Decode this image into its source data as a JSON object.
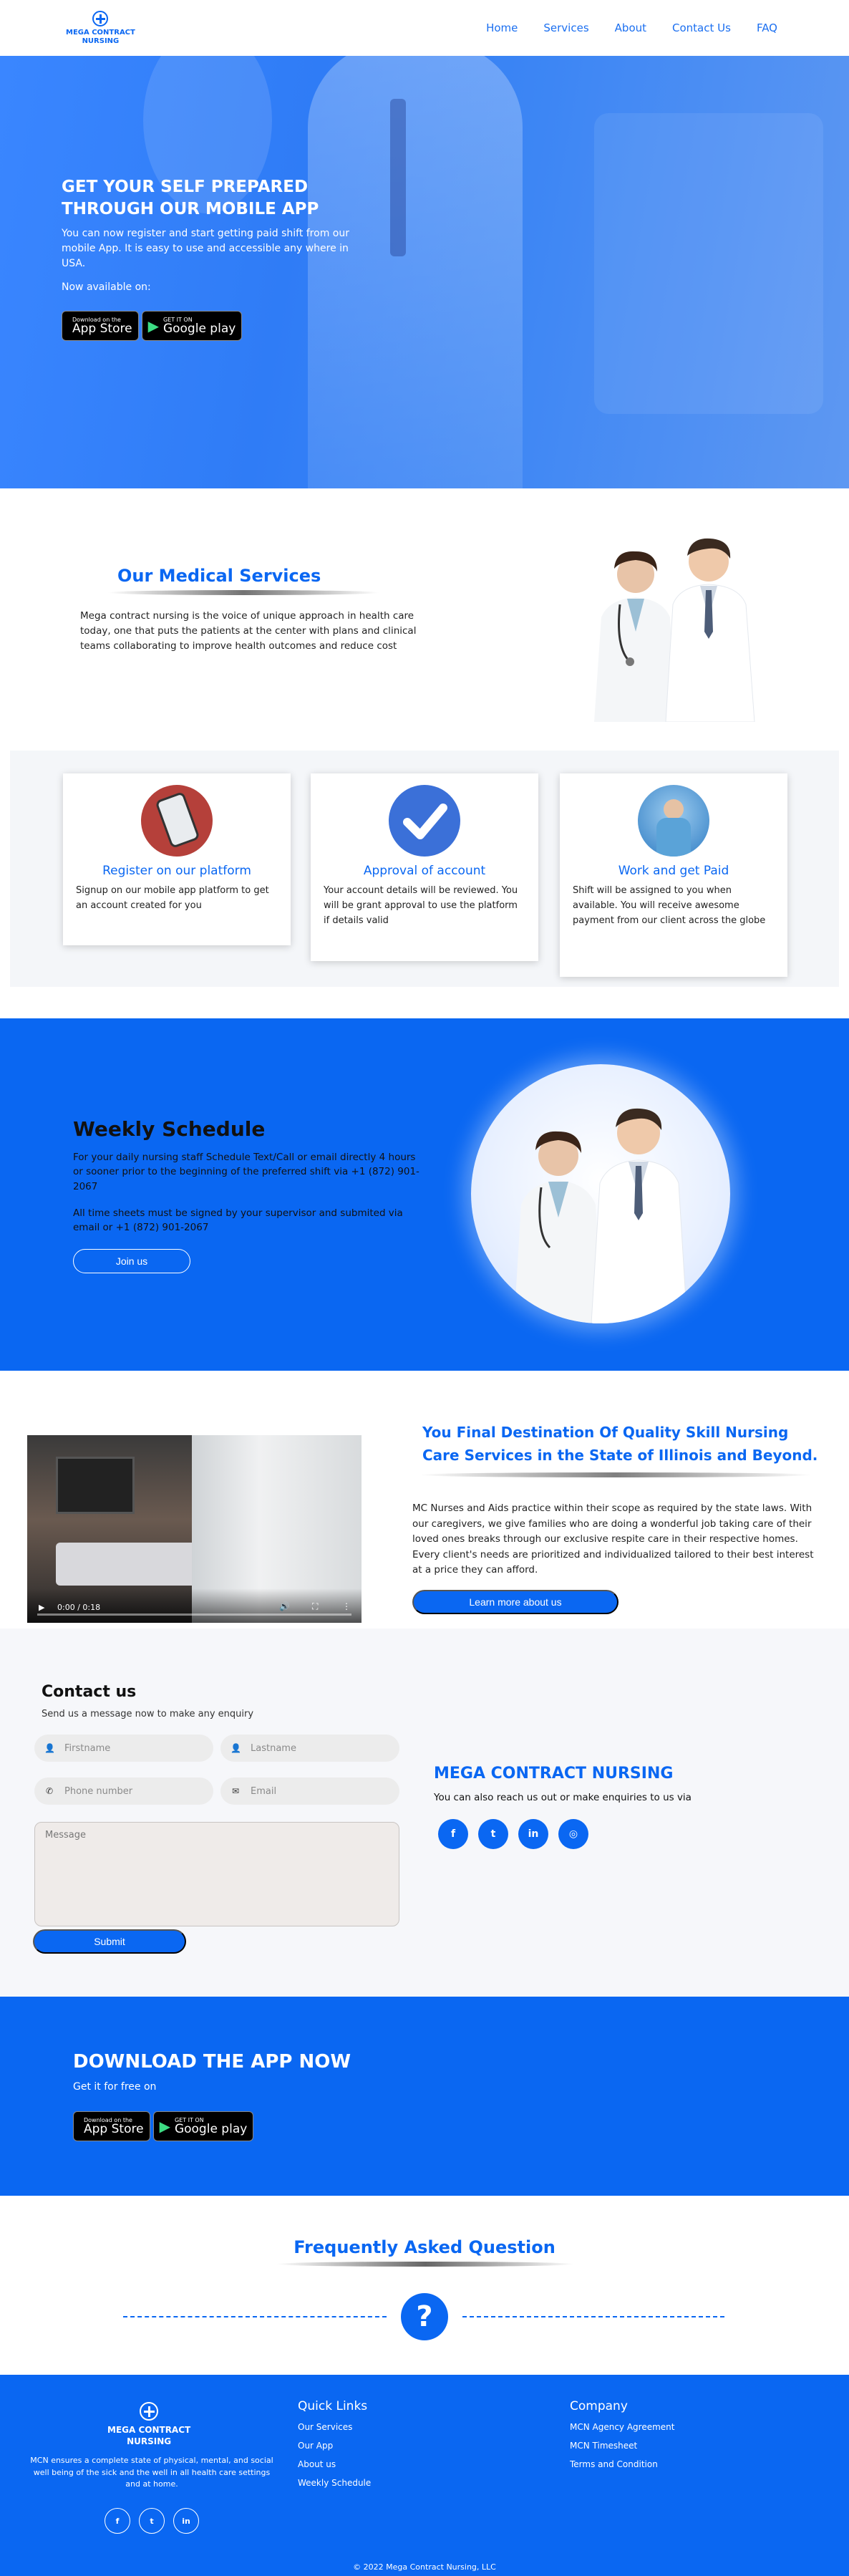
{
  "brand": {
    "line1": "MEGA CONTRACT",
    "line2": "NURSING"
  },
  "nav": {
    "items": [
      "Home",
      "Services",
      "About",
      "Contact Us",
      "FAQ"
    ]
  },
  "hero": {
    "title_line1": "GET YOUR SELF PREPARED",
    "title_line2": "THROUGH OUR MOBILE APP",
    "text": "You can now register and start getting paid shift from our mobile App. It is easy to use and accessible any where in USA.",
    "available": "Now available on:"
  },
  "badges": {
    "appstore_small": "Download on the",
    "appstore_big": "App Store",
    "play_small": "GET IT ON",
    "play_big": "Google play"
  },
  "medical": {
    "title": "Our Medical Services",
    "text": "Mega contract nursing is the voice of unique approach in health care today, one that puts the patients at the center with plans and clinical teams collaborating to improve health outcomes and reduce cost"
  },
  "steps": [
    {
      "title": "Register on our platform",
      "text": "Signup on our mobile app platform to get an account created for you"
    },
    {
      "title": "Approval of account",
      "text": "Your account details will be reviewed. You will be grant approval to use the platform if details valid"
    },
    {
      "title": "Work and get Paid",
      "text": "Shift will be assigned to you when available. You will receive awesome payment from our client across the globe"
    }
  ],
  "weekly": {
    "title": "Weekly Schedule",
    "p1": "For your daily nursing staff Schedule Text/Call or email directly 4 hours or sooner prior to the beginning of the preferred shift via +1 (872) 901-2067",
    "p2": "All time sheets must be signed by your supervisor and submited via email or +1 (872) 901-2067",
    "button": "Join us"
  },
  "video": {
    "time": "0:00 / 0:18"
  },
  "destination": {
    "title_line1": "You Final Destination Of Quality Skill Nursing",
    "title_line2": "Care Services in the State of Illinois and Beyond.",
    "text": "MC Nurses and Aids practice within their scope as required by the state laws. With our caregivers, we give families who are doing a wonderful job taking care of their loved ones breaks through our exclusive respite care in their respective homes. Every client's needs are prioritized and individualized tailored to their best interest at a price they can afford.",
    "button": "Learn more about us"
  },
  "contact": {
    "title": "Contact us",
    "subtitle": "Send us a message now to make any enquiry",
    "firstname": "Firstname",
    "lastname": "Lastname",
    "phone": "Phone number",
    "email": "Email",
    "message": "Message",
    "submit": "Submit",
    "brand": "MEGA CONTRACT NURSING",
    "reach": "You can also reach us out or make enquiries to us via"
  },
  "download": {
    "title": "DOWNLOAD THE APP NOW",
    "subtitle": "Get it for free on"
  },
  "faq": {
    "title": "Frequently Asked Question"
  },
  "footer": {
    "desc": "MCN ensures a complete state of physical, mental, and social well being of the sick and the well in all health care settings and at home.",
    "quick_title": "Quick Links",
    "quick": [
      "Our Services",
      "Our App",
      "About us",
      "Weekly Schedule"
    ],
    "company_title": "Company",
    "company": [
      "MCN Agency Agreement",
      "MCN Timesheet",
      "Terms and Condition"
    ],
    "copyright": "© 2022 Mega Contract Nursing, LLC"
  },
  "colors": {
    "primary": "#0a67f2",
    "hero": "#3a86ff",
    "light_bg": "#f6f7fa"
  }
}
